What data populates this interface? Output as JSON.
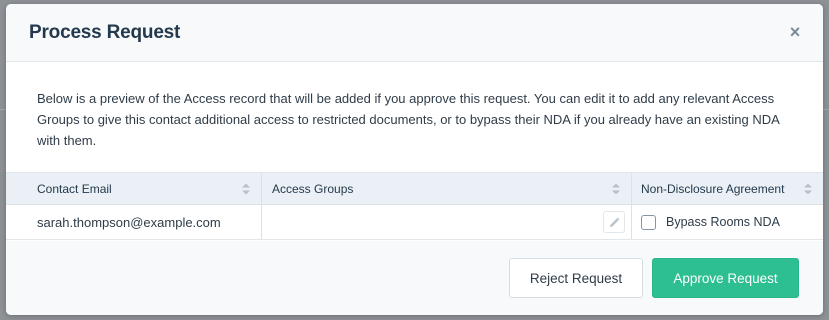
{
  "modal": {
    "title": "Process Request",
    "close_icon": "close-icon",
    "description": "Below is a preview of the Access record that will be added if you approve this request. You can edit it to add any relevant Access Groups to give this contact additional access to restricted documents, or to bypass their NDA if you already have an existing NDA with them.",
    "table": {
      "columns": [
        "Contact Email",
        "Access Groups",
        "Non-Disclosure Agreement"
      ],
      "row": {
        "email": "sarah.thompson@example.com",
        "access_groups": "",
        "bypass_label": "Bypass Rooms NDA",
        "bypass_checked": false
      }
    },
    "footer": {
      "reject_label": "Reject Request",
      "approve_label": "Approve Request"
    },
    "colors": {
      "approve": "#2dbf91",
      "header_bg": "#eaf0f5"
    }
  }
}
